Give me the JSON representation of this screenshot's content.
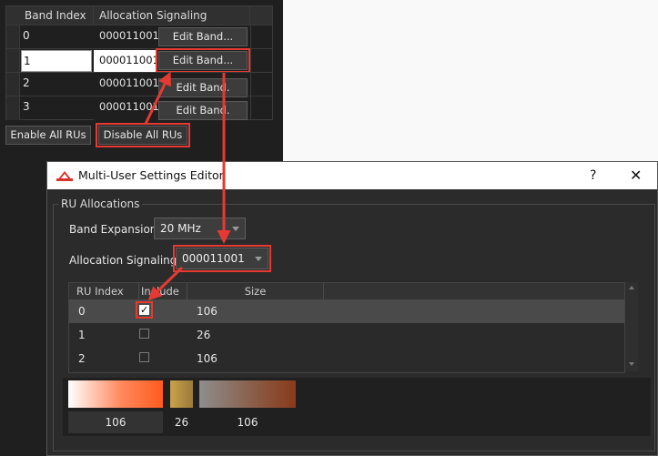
{
  "band_table": {
    "headers": [
      "Band Index",
      "Allocation Signaling"
    ],
    "rows": [
      {
        "index": "0",
        "allocation": "000011001",
        "button": "Edit Band..."
      },
      {
        "index": "1",
        "allocation": "000011001",
        "button": "Edit Band..."
      },
      {
        "index": "2",
        "allocation": "000011001",
        "button": "Edit Band."
      },
      {
        "index": "3",
        "allocation": "000011001",
        "button": "Edit Band."
      }
    ]
  },
  "buttons": {
    "enable_all": "Enable All RUs",
    "disable_all": "Disable All RUs"
  },
  "dialog": {
    "title": "Multi-User Settings Editor",
    "help": "?",
    "close": "✕",
    "group_title": "RU Allocations",
    "band_expansion_label": "Band Expansion:",
    "band_expansion_value": "20 MHz",
    "alloc_label": "Allocation Signaling:",
    "alloc_value": "000011001",
    "ru_table": {
      "headers": [
        "RU Index",
        "Include",
        "Size"
      ],
      "rows": [
        {
          "index": "0",
          "include": true,
          "size": "106"
        },
        {
          "index": "1",
          "include": false,
          "size": "26"
        },
        {
          "index": "2",
          "include": false,
          "size": "106"
        }
      ]
    },
    "preview": {
      "labels": [
        "106",
        "26",
        "106"
      ]
    }
  },
  "colors": {
    "highlight": "#e53a32",
    "dialog_bg": "#2b2b2b",
    "panel_bg": "#1f1f1f"
  }
}
